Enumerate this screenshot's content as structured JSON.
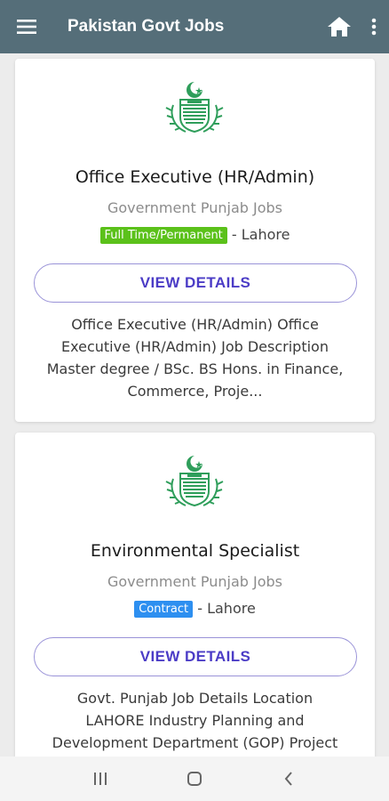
{
  "app": {
    "title": "Pakistan Govt Jobs"
  },
  "jobs": [
    {
      "title": "Office Executive (HR/Admin)",
      "org": "Government Punjab Jobs",
      "type": "Full Time/Permanent",
      "type_color": "#5bc11a",
      "location": "- Lahore",
      "button": "VIEW DETAILS",
      "desc_lines": [
        "Office Executive (HR/Admin) Office",
        "Executive (HR/Admin) Job Description",
        "Master degree / BSc. BS Hons. in Finance,",
        "Commerce, Proje..."
      ]
    },
    {
      "title": "Environmental Specialist",
      "org": "Government Punjab Jobs",
      "type": "Contract",
      "type_color": "#2d8ff0",
      "location": "- Lahore",
      "button": "VIEW DETAILS",
      "desc_lines": [
        "Govt. Punjab Job Details Location",
        "LAHORE Industry Planning and",
        "Development Department (GOP) Project"
      ]
    }
  ],
  "colors": {
    "appbar": "#556e79",
    "button_text": "#4b3cc6",
    "logo": "#2f9e5b"
  },
  "icons": [
    "menu-icon",
    "home-icon",
    "more-vert-icon",
    "recent-apps-icon",
    "home-nav-icon",
    "back-icon",
    "punjab-logo-icon"
  ]
}
